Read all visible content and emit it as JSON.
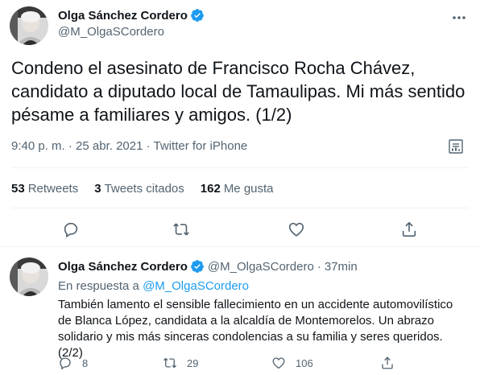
{
  "main_tweet": {
    "author_name": "Olga Sánchez Cordero",
    "author_handle": "@M_OlgaSCordero",
    "verified": true,
    "text": "Condeno el asesinato de Francisco Rocha Chávez, candidato a diputado local de Tamaulipas. Mi más sentido pésame a familiares y amigos. (1/2)",
    "time": "9:40 p. m.",
    "date": "25 abr. 2021",
    "separator": "·",
    "source": "Twitter for iPhone",
    "stats": [
      {
        "count": "53",
        "label": "Retweets"
      },
      {
        "count": "3",
        "label": "Tweets citados"
      },
      {
        "count": "162",
        "label": "Me gusta"
      }
    ],
    "icons": {
      "more": "more-icon",
      "analytics": "analytics-icon",
      "reply": "reply-icon",
      "retweet": "retweet-icon",
      "like": "heart-icon",
      "share": "share-icon"
    }
  },
  "reply_tweet": {
    "author_name": "Olga Sánchez Cordero",
    "author_handle": "@M_OlgaSCordero",
    "separator": "·",
    "time_ago": "37min",
    "in_reply_prefix": "En respuesta a",
    "in_reply_mention": "@M_OlgaSCordero",
    "text": "También lamento el sensible fallecimiento en un accidente automovilístico de Blanca López, candidata a la alcaldía de Montemorelos. Un abrazo solidario y mis más sinceras condolencias a su familia y seres queridos. (2/2)",
    "reply_count": "8",
    "retweet_count": "29",
    "like_count": "106"
  },
  "colors": {
    "text": "#0f1419",
    "secondary": "#536471",
    "accent": "#1d9bf0",
    "divider": "#eff3f4"
  }
}
